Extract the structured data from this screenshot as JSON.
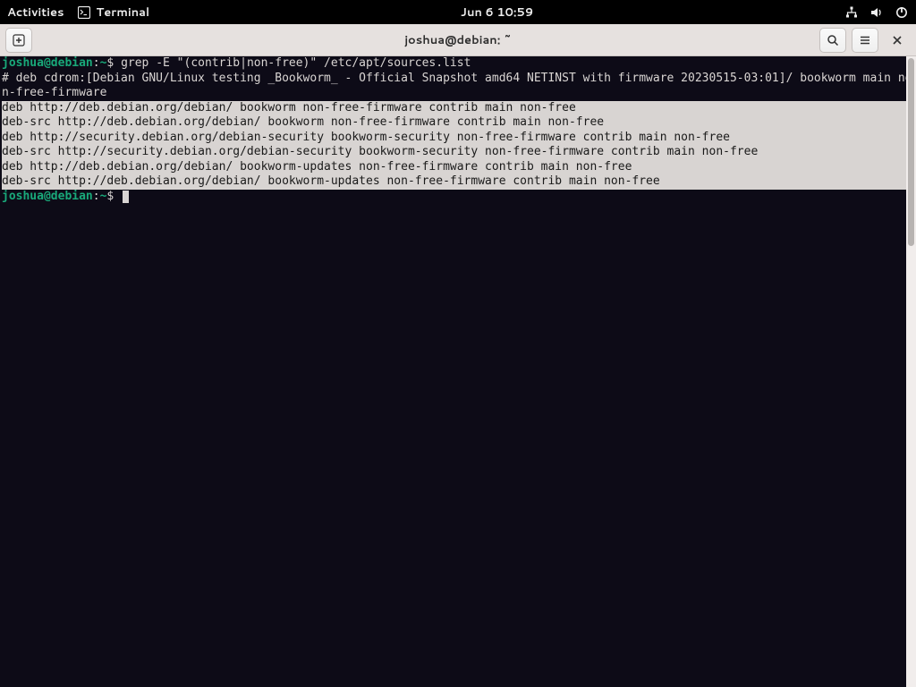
{
  "topbar": {
    "activities": "Activities",
    "app_name": "Terminal",
    "clock": "Jun 6  10:59"
  },
  "titlebar": {
    "title": "joshua@debian: ~"
  },
  "prompt": {
    "user_host": "joshua@debian",
    "sep1": ":",
    "path": "~",
    "sigil": "$ "
  },
  "command": "grep -E \"(contrib|non-free)\" /etc/apt/sources.list",
  "output": {
    "comment_line": "# deb cdrom:[Debian GNU/Linux testing _Bookworm_ - Official Snapshot amd64 NETINST with firmware 20230515-03:01]/ bookworm main non-free-firmware",
    "matches": [
      "deb http://deb.debian.org/debian/ bookworm non-free-firmware contrib main non-free",
      "deb-src http://deb.debian.org/debian/ bookworm non-free-firmware contrib main non-free",
      "deb http://security.debian.org/debian-security bookworm-security non-free-firmware contrib main non-free",
      "deb-src http://security.debian.org/debian-security bookworm-security non-free-firmware contrib main non-free",
      "deb http://deb.debian.org/debian/ bookworm-updates non-free-firmware contrib main non-free",
      "deb-src http://deb.debian.org/debian/ bookworm-updates non-free-firmware contrib main non-free"
    ]
  }
}
